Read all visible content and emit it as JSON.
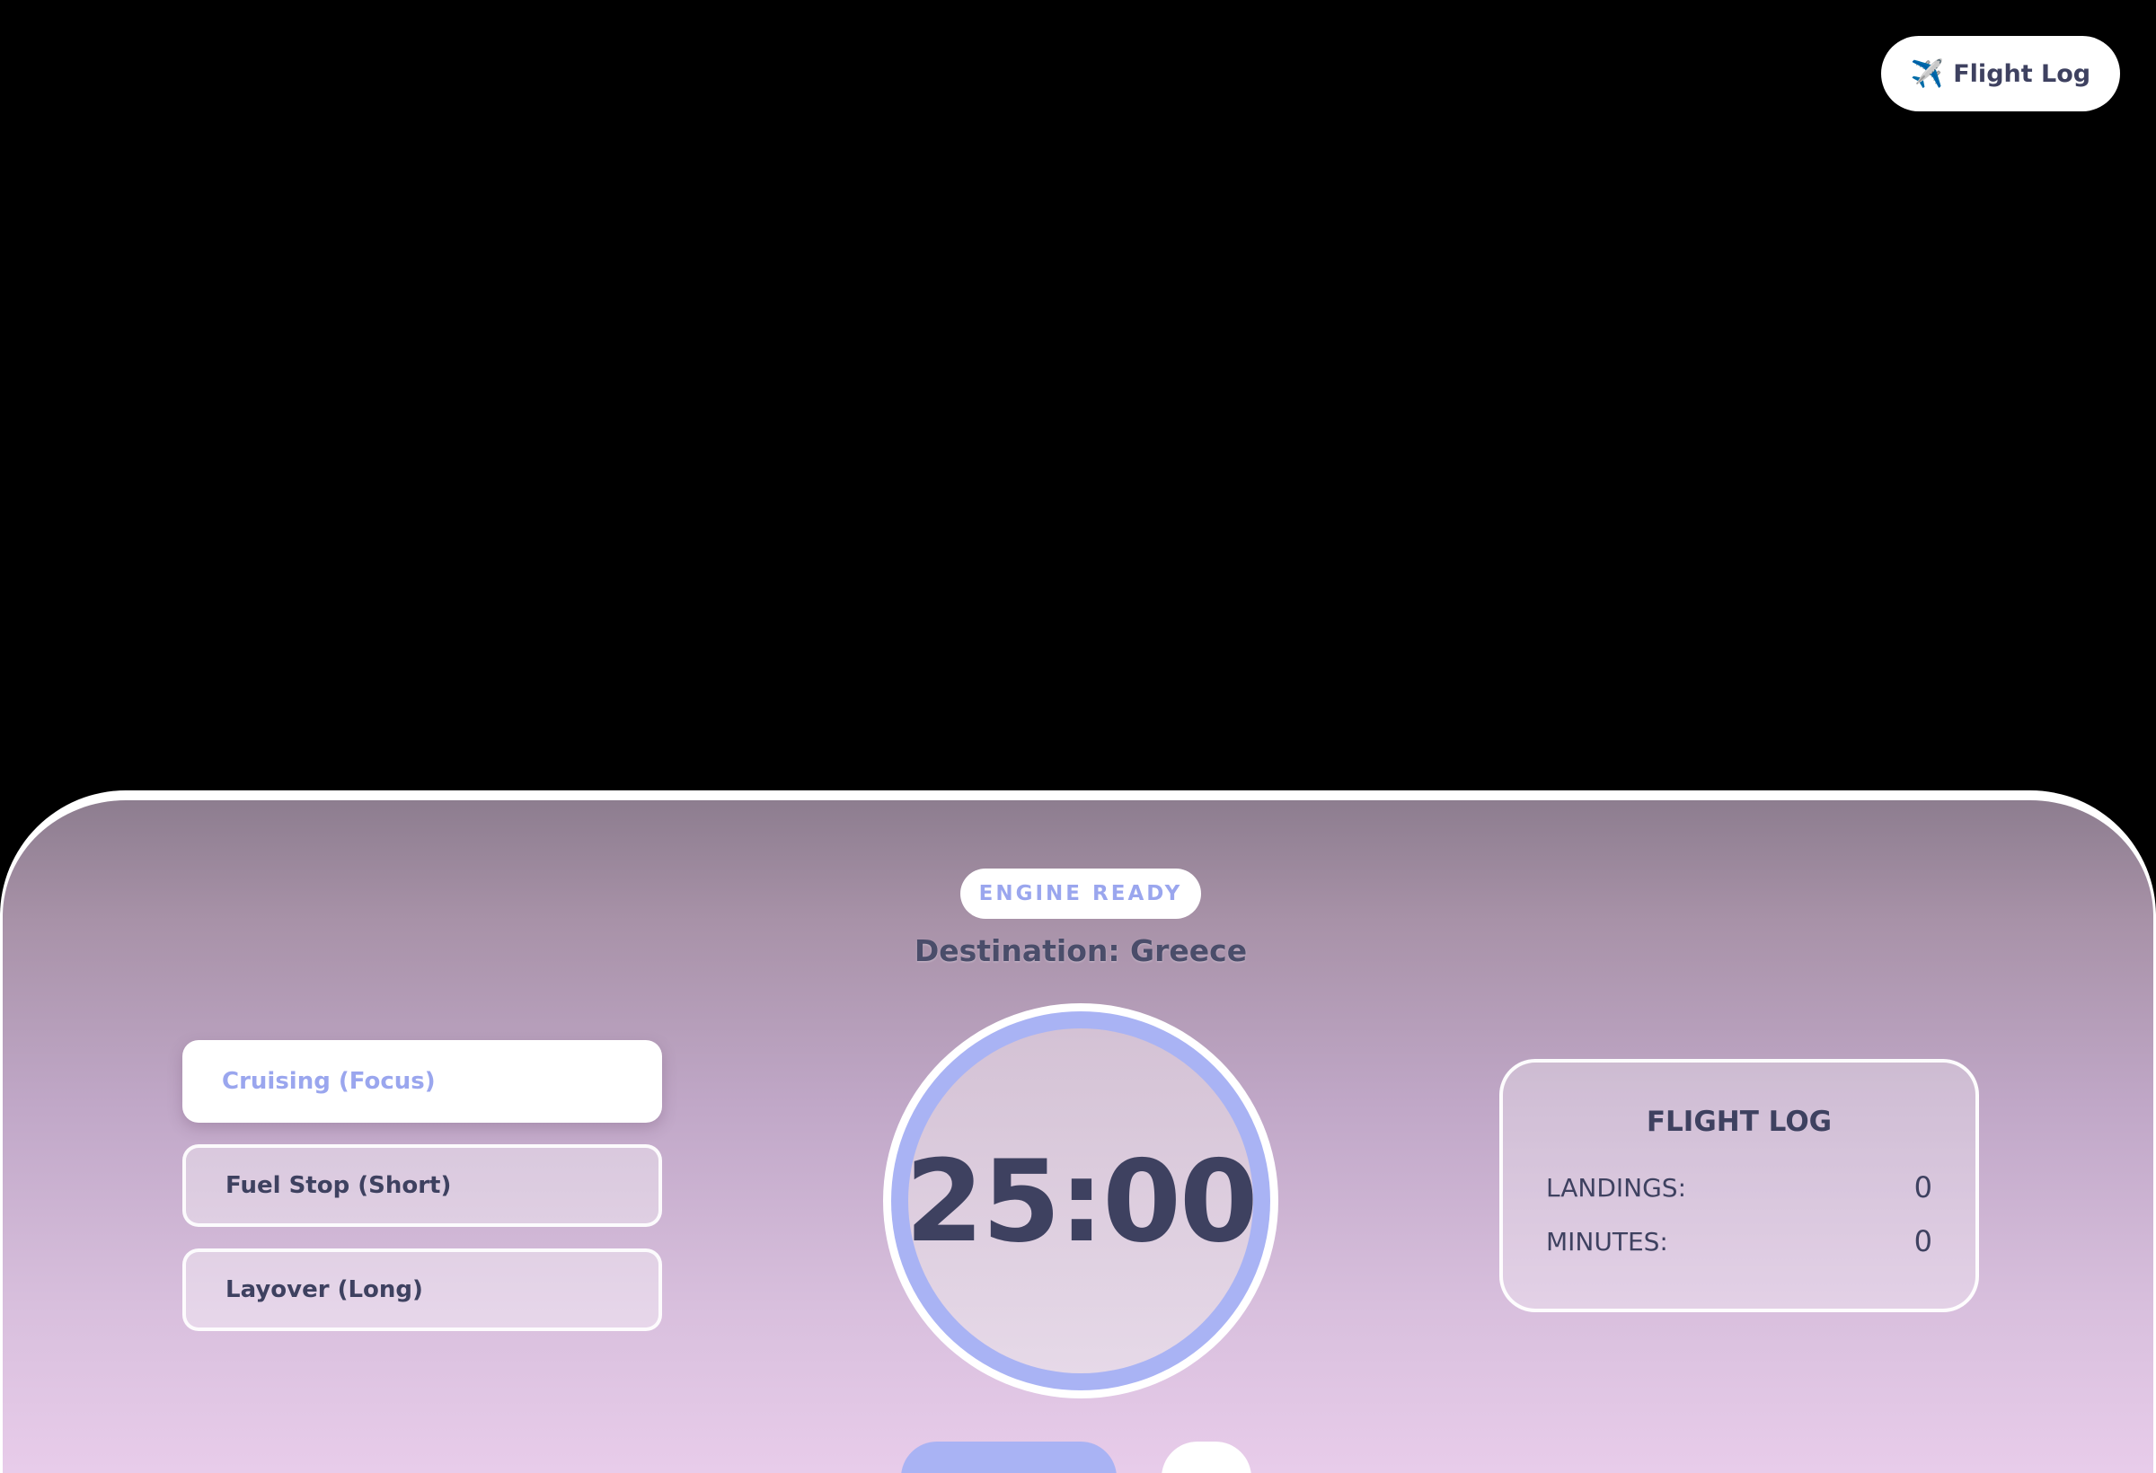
{
  "header": {
    "log_button": {
      "icon": "airplane-icon",
      "glyph": "✈️",
      "label": "Flight Log"
    }
  },
  "status": {
    "badge": "ENGINE READY",
    "destination": "Destination: Greece"
  },
  "modes": [
    {
      "label": "Cruising (Focus)",
      "active": true
    },
    {
      "label": "Fuel Stop (Short)",
      "active": false
    },
    {
      "label": "Layover (Long)",
      "active": false
    }
  ],
  "timer": {
    "display": "25:00"
  },
  "stats": {
    "title": "FLIGHT LOG",
    "rows": [
      {
        "label": "LANDINGS:",
        "value": "0"
      },
      {
        "label": "MINUTES:",
        "value": "0"
      }
    ]
  },
  "colors": {
    "accent": "#a9b3f4",
    "text_dark": "#3e4160",
    "panel_top": "#8d7d8f",
    "panel_bottom": "#e8ccea"
  }
}
